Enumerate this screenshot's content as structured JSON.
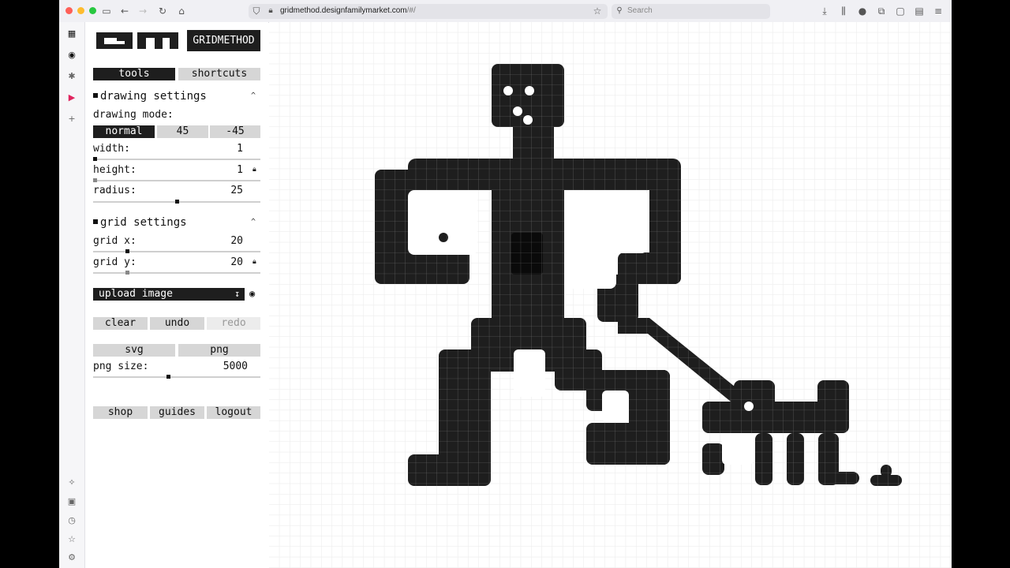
{
  "browser": {
    "url_host": "gridmethod.designfamilymarket.com",
    "url_path": "/#/",
    "search_placeholder": "Search",
    "icons": [
      "sidebar-toggle-icon",
      "back-icon",
      "forward-icon",
      "reload-icon",
      "home-icon",
      "shield-icon",
      "lock-icon",
      "bookmark-star-icon",
      "download-icon",
      "library-icon",
      "account-icon",
      "extensions-icon",
      "container-icon",
      "sidebar-icon",
      "menu-icon"
    ]
  },
  "app": {
    "logo_text": "GRIDMETHOD",
    "tabs": {
      "tools": "tools",
      "shortcuts": "shortcuts"
    },
    "drawing_settings": {
      "title": "drawing settings",
      "mode_label": "drawing mode:",
      "modes": [
        "normal",
        "45",
        "-45"
      ],
      "active_mode": "normal",
      "width_label": "width:",
      "width": "1",
      "width_level": 0.0,
      "height_label": "height:",
      "height": "1",
      "height_level": 0.0,
      "radius_label": "radius:",
      "radius": "25",
      "radius_level": 0.5
    },
    "grid_settings": {
      "title": "grid settings",
      "x_label": "grid x:",
      "x": "20",
      "x_level": 0.2,
      "y_label": "grid y:",
      "y": "20",
      "y_level": 0.2
    },
    "upload_label": "upload image",
    "actions": {
      "clear": "clear",
      "undo": "undo",
      "redo": "redo"
    },
    "export": {
      "svg": "svg",
      "png": "png",
      "png_size_label": "png size:",
      "png_size": "5000",
      "png_size_level": 0.45
    },
    "footer": {
      "shop": "shop",
      "guides": "guides",
      "logout": "logout"
    }
  },
  "colors": {
    "ink": "#1e1e1e",
    "grid_line": "#e6e6e6",
    "button_light": "#d6d6d6"
  }
}
